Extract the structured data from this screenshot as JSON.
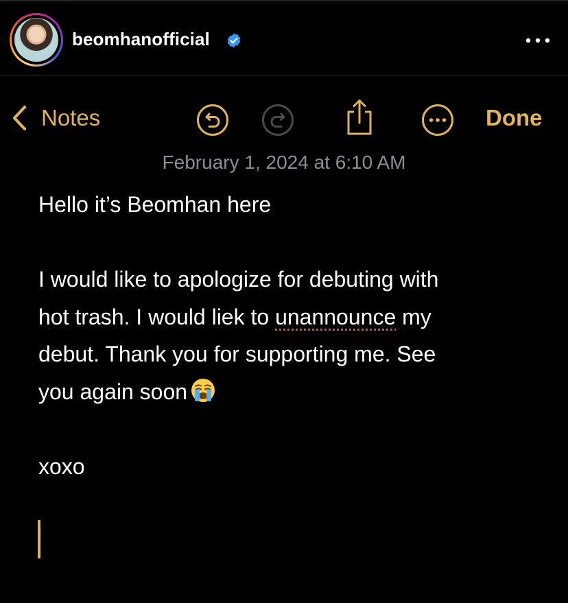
{
  "post": {
    "username": "beomhanofficial",
    "verified": true
  },
  "toolbar": {
    "back_label": "Notes",
    "done_label": "Done",
    "accent_color": "#E1B35A"
  },
  "note": {
    "timestamp": "February 1, 2024 at 6:10 AM",
    "line1": "Hello it’s Beomhan here",
    "line3a": "I would like to apologize for debuting with",
    "line4_prefix": "hot trash. I would liek to ",
    "line4_misspelled": "unannounce",
    "line4_suffix": " my",
    "line5": "debut. Thank you for supporting me. See",
    "line6": "you again soon",
    "line6_emoji": "crying-face-emoji",
    "signoff": "xoxo"
  },
  "icons": {
    "verified": "verified-badge-icon",
    "more": "more-options-icon",
    "back": "chevron-left-icon",
    "undo": "undo-icon",
    "redo": "redo-icon",
    "share": "share-icon",
    "ellipsis": "ellipsis-circle-icon"
  }
}
